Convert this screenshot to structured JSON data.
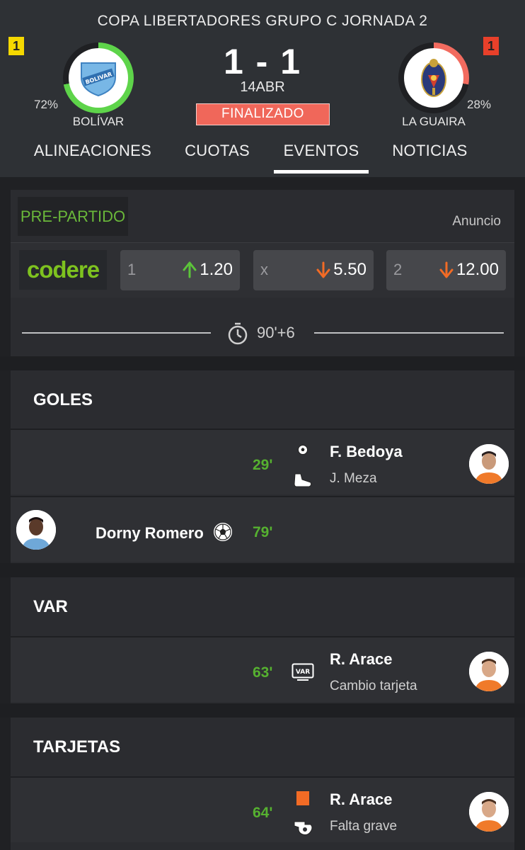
{
  "header": {
    "competition": "COPA LIBERTADORES  GRUPO C JORNADA 2",
    "score": "1 - 1",
    "date": "14ABR",
    "status": "FINALIZADO",
    "home": {
      "name": "BOLÍVAR",
      "possession": "72%",
      "cards": "1",
      "ring_color": "#5ed44a",
      "possession_fraction": 0.72
    },
    "away": {
      "name": "LA GUAIRA",
      "possession": "28%",
      "cards": "1",
      "ring_color": "#f26b5f",
      "possession_fraction": 0.28
    }
  },
  "tabs": [
    {
      "label": "ALINEACIONES",
      "active": false
    },
    {
      "label": "CUOTAS",
      "active": false
    },
    {
      "label": "EVENTOS",
      "active": true
    },
    {
      "label": "NOTICIAS",
      "active": false
    }
  ],
  "prematch": {
    "tab_label": "PRE-PARTIDO",
    "ad_label": "Anuncio",
    "bookmaker": "codere",
    "odds": [
      {
        "label": "1",
        "value": "1.20",
        "trend": "up"
      },
      {
        "label": "x",
        "value": "5.50",
        "trend": "down"
      },
      {
        "label": "2",
        "value": "12.00",
        "trend": "down"
      }
    ]
  },
  "time_marker": "90'+6",
  "sections": {
    "goals": {
      "title": "GOLES",
      "events": [
        {
          "side": "away",
          "minute": "29'",
          "player": "F. Bedoya",
          "assist": "J. Meza"
        },
        {
          "side": "home",
          "minute": "79'",
          "player": "Dorny Romero"
        }
      ]
    },
    "var": {
      "title": "VAR",
      "events": [
        {
          "side": "away",
          "minute": "63'",
          "player": "R. Arace",
          "detail": "Cambio tarjeta"
        }
      ]
    },
    "cards": {
      "title": "TARJETAS",
      "events": [
        {
          "side": "away",
          "minute": "64'",
          "player": "R. Arace",
          "detail": "Falta grave"
        }
      ]
    }
  },
  "colors": {
    "accent_green": "#56b130",
    "status_red": "#f0675a",
    "arrow_up": "#5cc43a",
    "arrow_down": "#f26b25"
  },
  "icons": [
    "clock-icon",
    "goal-ball-icon",
    "assist-boot-icon",
    "var-screen-icon",
    "red-card-icon",
    "whistle-icon"
  ]
}
